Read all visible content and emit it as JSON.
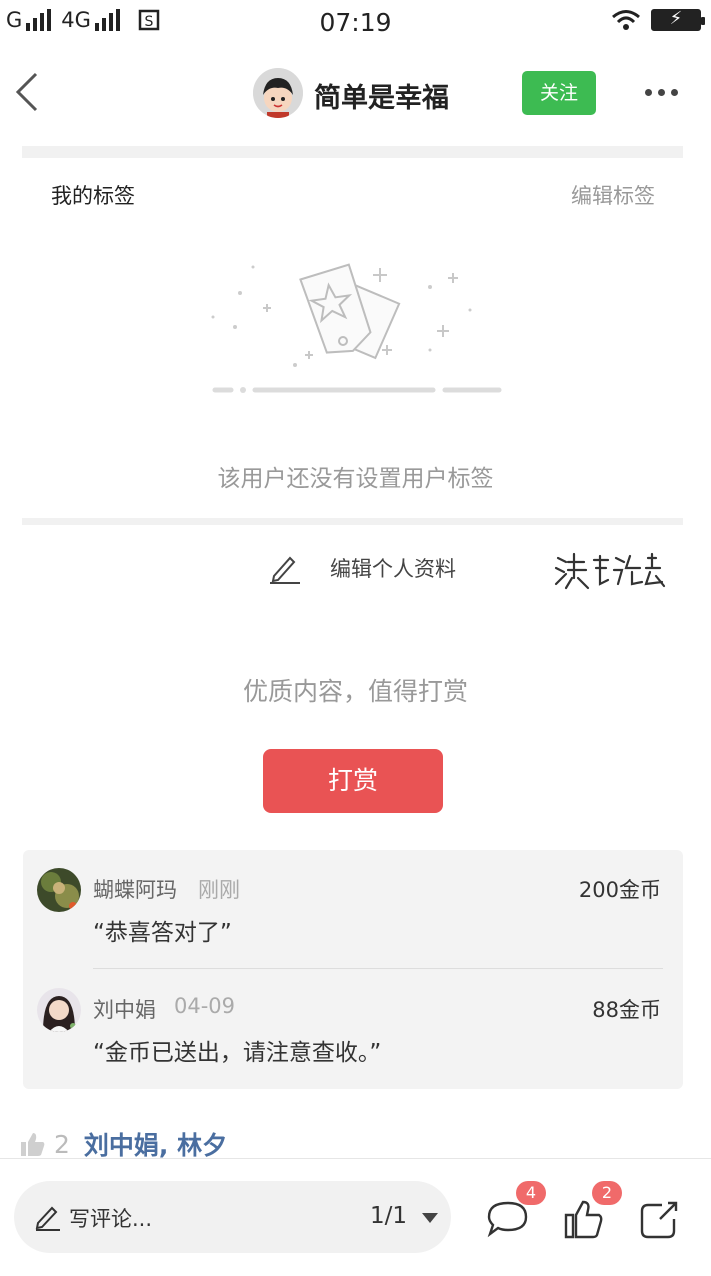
{
  "status_bar": {
    "carrier1": "G",
    "carrier2": "4G",
    "time": "07:19"
  },
  "nav": {
    "title": "简单是幸福",
    "follow_label": "关注"
  },
  "tags": {
    "title": "我的标签",
    "edit_label": "编辑标签",
    "empty_text": "该用户还没有设置用户标签"
  },
  "profile": {
    "edit_label": "编辑个人资料"
  },
  "reward": {
    "prompt": "优质内容，值得打赏",
    "button_label": "打赏",
    "items": [
      {
        "name": "蝴蝶阿玛",
        "time": "刚刚",
        "coins": "200金币",
        "message": "“恭喜答对了”"
      },
      {
        "name": "刘中娟",
        "time": "04-09",
        "coins": "88金币",
        "message": "“金币已送出，请注意查收。”"
      }
    ]
  },
  "likes": {
    "count": "2",
    "names": "刘中娟, 林夕"
  },
  "bottom_bar": {
    "comment_placeholder": "写评论...",
    "page_indicator": "1/1",
    "comment_badge": "4",
    "like_badge": "2"
  },
  "colors": {
    "follow_green": "#3dbb52",
    "reward_red": "#e95354",
    "badge_red": "#f06a6a",
    "link_blue": "#4a6ea0"
  }
}
